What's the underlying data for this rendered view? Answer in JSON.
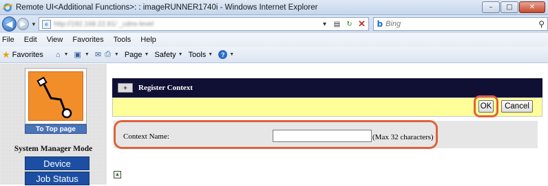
{
  "window": {
    "title": "Remote UI<Additional Functions>: : imageRUNNER1740i - Windows Internet Explorer",
    "minimize": "–",
    "maximize": "□",
    "close": "✕"
  },
  "address_bar": {
    "url": "http://192.168.22.81/  _cdns-level",
    "back": "◀",
    "forward": "▶"
  },
  "search": {
    "provider": "Bing",
    "placeholder": "Bing"
  },
  "menu": [
    "File",
    "Edit",
    "View",
    "Favorites",
    "Tools",
    "Help"
  ],
  "command_bar": {
    "favorites": "Favorites",
    "page": "Page",
    "safety": "Safety",
    "tools": "Tools"
  },
  "sidebar": {
    "to_top_label": "To Top page",
    "mode_label": "System Manager Mode",
    "nav": [
      "Device",
      "Job Status"
    ]
  },
  "main": {
    "header_title": "Register Context",
    "ok_label": "OK",
    "cancel_label": "Cancel",
    "context_name_label": "Context Name:",
    "context_name_value": "",
    "max_note": "(Max 32 characters)"
  },
  "colors": {
    "header_bg": "#101034",
    "action_bar_bg": "#ffff99",
    "nav_button_bg": "#1c4fa3",
    "highlight_ring": "#e0603a"
  }
}
